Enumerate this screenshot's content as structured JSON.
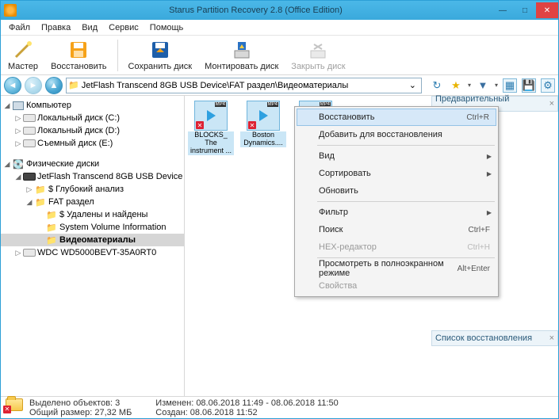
{
  "title": "Starus Partition Recovery 2.8 (Office Edition)",
  "menu": {
    "file": "Файл",
    "edit": "Правка",
    "view": "Вид",
    "service": "Сервис",
    "help": "Помощь"
  },
  "toolbar": {
    "wizard": "Мастер",
    "recover": "Восстановить",
    "save_disk": "Сохранить диск",
    "mount_disk": "Монтировать диск",
    "close_disk": "Закрыть диск"
  },
  "path": "JetFlash Transcend 8GB USB Device\\FAT раздел\\Видеоматериалы",
  "tree": {
    "computer": "Компьютер",
    "local_c": "Локальный диск (C:)",
    "local_d": "Локальный диск (D:)",
    "removable_e": "Съемный диск (E:)",
    "phys": "Физические диски",
    "jetflash": "JetFlash Transcend 8GB USB Device",
    "deep": "$ Глубокий анализ",
    "fat": "FAT раздел",
    "deleted": "$ Удалены и найдены",
    "svi": "System Volume Information",
    "video": "Видеоматериалы",
    "wdc": "WDC WD5000BEVT-35A0RT0"
  },
  "files": [
    {
      "name": "BLOCKS_ The instrument ..."
    },
    {
      "name": "Boston Dynamics...."
    },
    {
      "name": ""
    }
  ],
  "panels": {
    "preview": "Предварительный просмотр",
    "reclist": "Список восстановления"
  },
  "ctx": {
    "recover": "Восстановить",
    "recover_sc": "Ctrl+R",
    "add": "Добавить для восстановления",
    "view": "Вид",
    "sort": "Сортировать",
    "refresh": "Обновить",
    "filter": "Фильтр",
    "search": "Поиск",
    "search_sc": "Ctrl+F",
    "hex": "HEX-редактор",
    "hex_sc": "Ctrl+H",
    "fullscreen": "Просмотреть в полноэкранном режиме",
    "fullscreen_sc": "Alt+Enter",
    "props": "Свойства"
  },
  "status": {
    "selected_label": "Выделено объектов: ",
    "selected_count": "3",
    "size_label": "Общий размер: ",
    "size_value": "27,32 МБ",
    "modified_label": "Изменен: ",
    "modified_value": "08.06.2018 11:49 - 08.06.2018 11:50",
    "created_label": "Создан: ",
    "created_value": "08.06.2018 11:52"
  }
}
